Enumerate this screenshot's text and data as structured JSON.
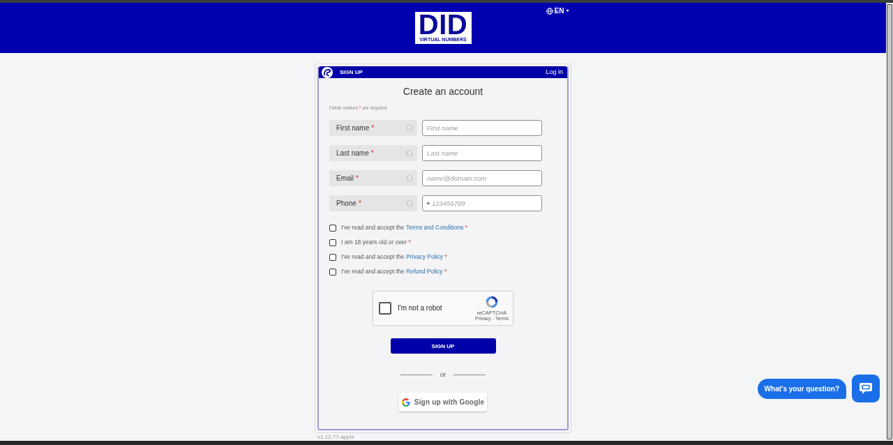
{
  "header": {
    "logo": {
      "wordmark": "DID",
      "tagline": "VIRTUAL NUMBERS"
    },
    "language": {
      "label": "EN"
    }
  },
  "card": {
    "header": {
      "title": "SIGN UP",
      "link": "Log in"
    },
    "title": "Create an account",
    "required_note": {
      "before": "Fields marked",
      "mark": "*",
      "after": "are required"
    },
    "fields": [
      {
        "label": "First name",
        "mark": "*",
        "placeholder": "First name"
      },
      {
        "label": "Last name",
        "mark": "*",
        "placeholder": "Last name"
      },
      {
        "label": "Email",
        "mark": "*",
        "placeholder": "name@domain.com"
      },
      {
        "label": "Phone",
        "mark": "*",
        "prefix": "+",
        "placeholder": "123456789"
      }
    ],
    "agreements": [
      {
        "text": "I've read and accept the",
        "link": "Terms and Conditions",
        "mark": "*",
        "checked": false
      },
      {
        "text": "I am 18 years old or over",
        "mark": "*",
        "checked": false
      },
      {
        "text": "I've read and accept the",
        "link": "Privacy Policy",
        "mark": "*",
        "checked": false
      },
      {
        "text": "I've read and accept the",
        "link": "Refund Policy",
        "mark": "*",
        "checked": false
      }
    ],
    "captcha": {
      "label": "I'm not a robot",
      "checked": false,
      "brand": "reCAPTCHA",
      "terms": "Privacy - Terms"
    },
    "submit": "SIGN UP",
    "divider": "or",
    "google_button": "Sign up with Google"
  },
  "version": "v1.12.77-apple",
  "chat": {
    "prompt": "What's your question?"
  }
}
